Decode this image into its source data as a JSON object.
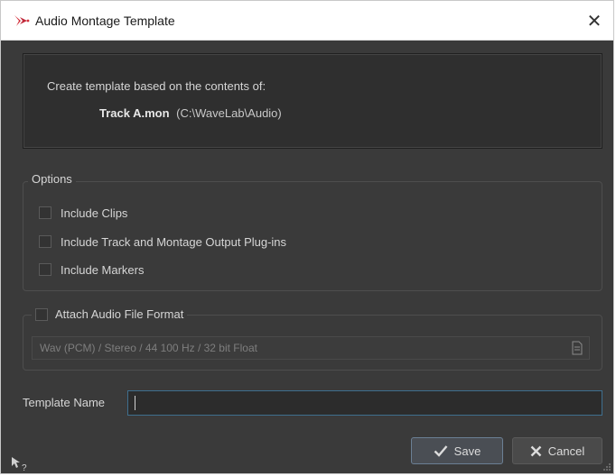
{
  "window": {
    "title": "Audio Montage Template"
  },
  "info": {
    "line1": "Create template based on the contents of:",
    "track_name": "Track A.mon",
    "track_path": "(C:\\WaveLab\\Audio)"
  },
  "options": {
    "legend": "Options",
    "items": [
      {
        "label": "Include Clips",
        "checked": false
      },
      {
        "label": "Include Track and Montage Output Plug-ins",
        "checked": false
      },
      {
        "label": "Include Markers",
        "checked": false
      }
    ]
  },
  "format": {
    "legend": "Attach Audio File Format",
    "checked": false,
    "value": "Wav (PCM) / Stereo / 44 100 Hz / 32 bit Float"
  },
  "template_name": {
    "label": "Template Name",
    "value": ""
  },
  "buttons": {
    "save": "Save",
    "cancel": "Cancel"
  },
  "icons": {
    "app": "wavelab-logo-icon",
    "close": "close-icon",
    "file": "file-icon",
    "save": "checkmark-icon",
    "cancel": "x-icon",
    "help": "whats-this-help-icon",
    "grip": "resize-grip-icon"
  },
  "colors": {
    "accent_border": "#3f6f8e",
    "logo": "#d32f3a"
  }
}
